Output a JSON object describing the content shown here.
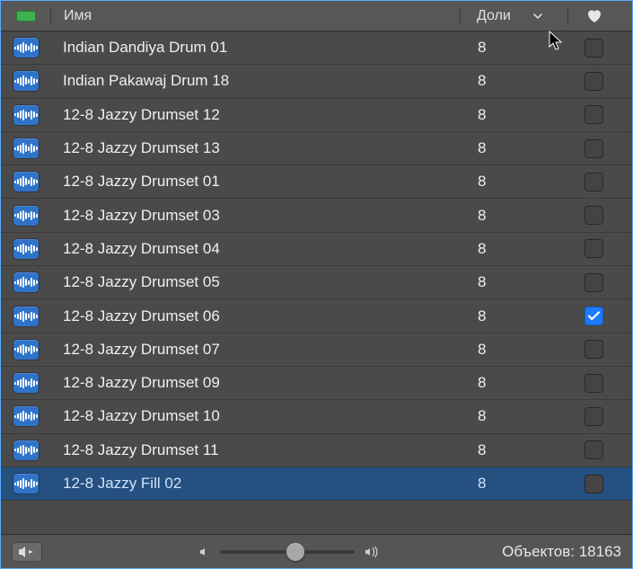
{
  "header": {
    "name_label": "Имя",
    "beats_label": "Доли"
  },
  "loops": [
    {
      "name": "Indian Dandiya Drum 01",
      "beats": "8",
      "fav": false,
      "selected": false
    },
    {
      "name": "Indian Pakawaj Drum 18",
      "beats": "8",
      "fav": false,
      "selected": false
    },
    {
      "name": "12-8 Jazzy Drumset 12",
      "beats": "8",
      "fav": false,
      "selected": false
    },
    {
      "name": "12-8 Jazzy Drumset 13",
      "beats": "8",
      "fav": false,
      "selected": false
    },
    {
      "name": "12-8 Jazzy Drumset 01",
      "beats": "8",
      "fav": false,
      "selected": false
    },
    {
      "name": "12-8 Jazzy Drumset 03",
      "beats": "8",
      "fav": false,
      "selected": false
    },
    {
      "name": "12-8 Jazzy Drumset 04",
      "beats": "8",
      "fav": false,
      "selected": false
    },
    {
      "name": "12-8 Jazzy Drumset 05",
      "beats": "8",
      "fav": false,
      "selected": false
    },
    {
      "name": "12-8 Jazzy Drumset 06",
      "beats": "8",
      "fav": true,
      "selected": false
    },
    {
      "name": "12-8 Jazzy Drumset 07",
      "beats": "8",
      "fav": false,
      "selected": false
    },
    {
      "name": "12-8 Jazzy Drumset 09",
      "beats": "8",
      "fav": false,
      "selected": false
    },
    {
      "name": "12-8 Jazzy Drumset 10",
      "beats": "8",
      "fav": false,
      "selected": false
    },
    {
      "name": "12-8 Jazzy Drumset 11",
      "beats": "8",
      "fav": false,
      "selected": false
    },
    {
      "name": "12-8 Jazzy Fill 02",
      "beats": "8",
      "fav": false,
      "selected": true
    }
  ],
  "footer": {
    "count_label": "Объектов: 18163"
  }
}
